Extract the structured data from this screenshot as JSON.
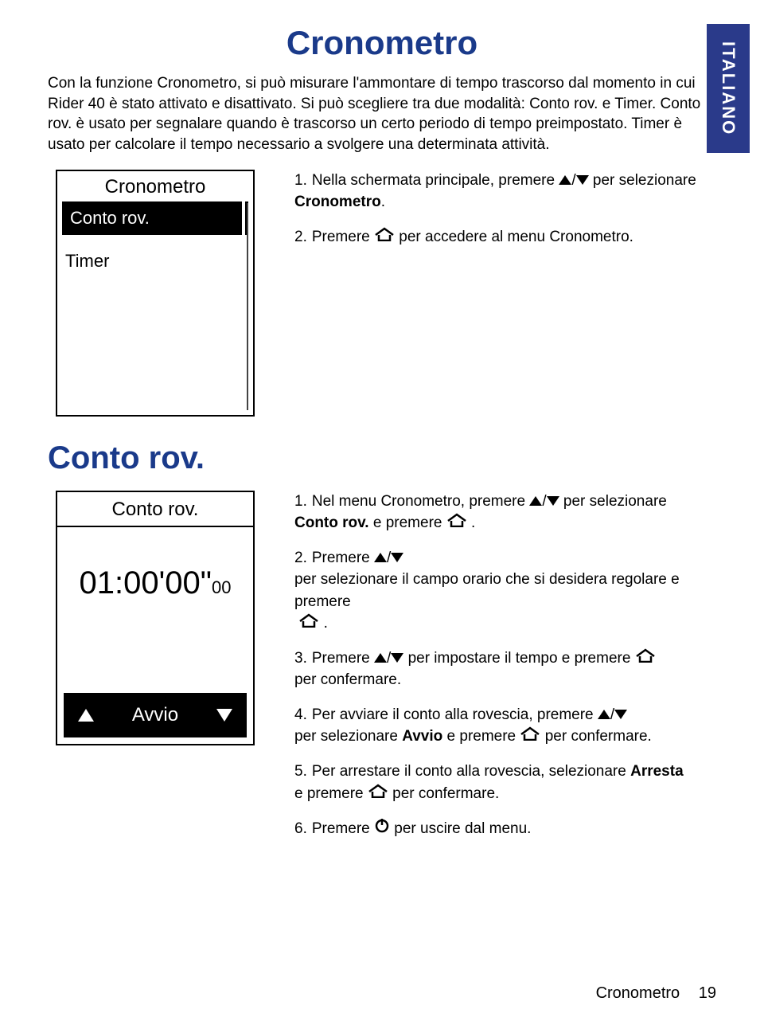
{
  "sideTab": "ITALIANO",
  "title": "Cronometro",
  "intro": "Con la funzione Cronometro, si può misurare l'ammontare di tempo trascorso dal momento in cui Rider 40 è stato attivato e disattivato. Si può scegliere tra due modalità: Conto rov. e Timer. Conto rov. è usato per segnalare quando è trascorso un certo periodo di tempo preimpostato. Timer è usato per calcolare il tempo necessario a svolgere una determinata attività.",
  "screen1": {
    "header": "Cronometro",
    "selected": "Conto rov.",
    "item2": "Timer"
  },
  "steps1": {
    "s1a": "1.",
    "s1b": "Nella schermata principale, premere",
    "s1c": "per selezionare",
    "s1d": "Cronometro",
    "s1e": ".",
    "s2a": "2.",
    "s2b": "Premere",
    "s2c": "per accedere al menu Cronometro."
  },
  "section2": "Conto rov.",
  "screen2": {
    "header": "Conto rov.",
    "time_main": "01:00'00\"",
    "time_sub": "00",
    "bottom_label": "Avvio"
  },
  "steps2": {
    "s1a": "1.",
    "s1b": "Nel menu Cronometro, premere",
    "s1c": "per selezionare",
    "s1d": "Conto rov.",
    "s1e": "e premere",
    "s1f": ".",
    "s2a": "2.",
    "s2b": "Premere",
    "s2c": "per selezionare il campo orario che si desidera regolare e premere",
    "s2d": ".",
    "s3a": "3.",
    "s3b": "Premere",
    "s3c": "per impostare il tempo e premere",
    "s3d": "per confermare.",
    "s4a": "4.",
    "s4b": "Per avviare il conto alla rovescia, premere",
    "s4c": "per selezionare",
    "s4d": "Avvio",
    "s4e": "e premere",
    "s4f": "per confermare.",
    "s5a": "5.",
    "s5b": "Per arrestare il conto alla rovescia, selezionare",
    "s5c": "Arresta",
    "s5d": "e premere",
    "s5e": "per confermare.",
    "s6a": "6.",
    "s6b": "Premere",
    "s6c": "per uscire dal menu."
  },
  "footer": {
    "label": "Cronometro",
    "page": "19"
  }
}
